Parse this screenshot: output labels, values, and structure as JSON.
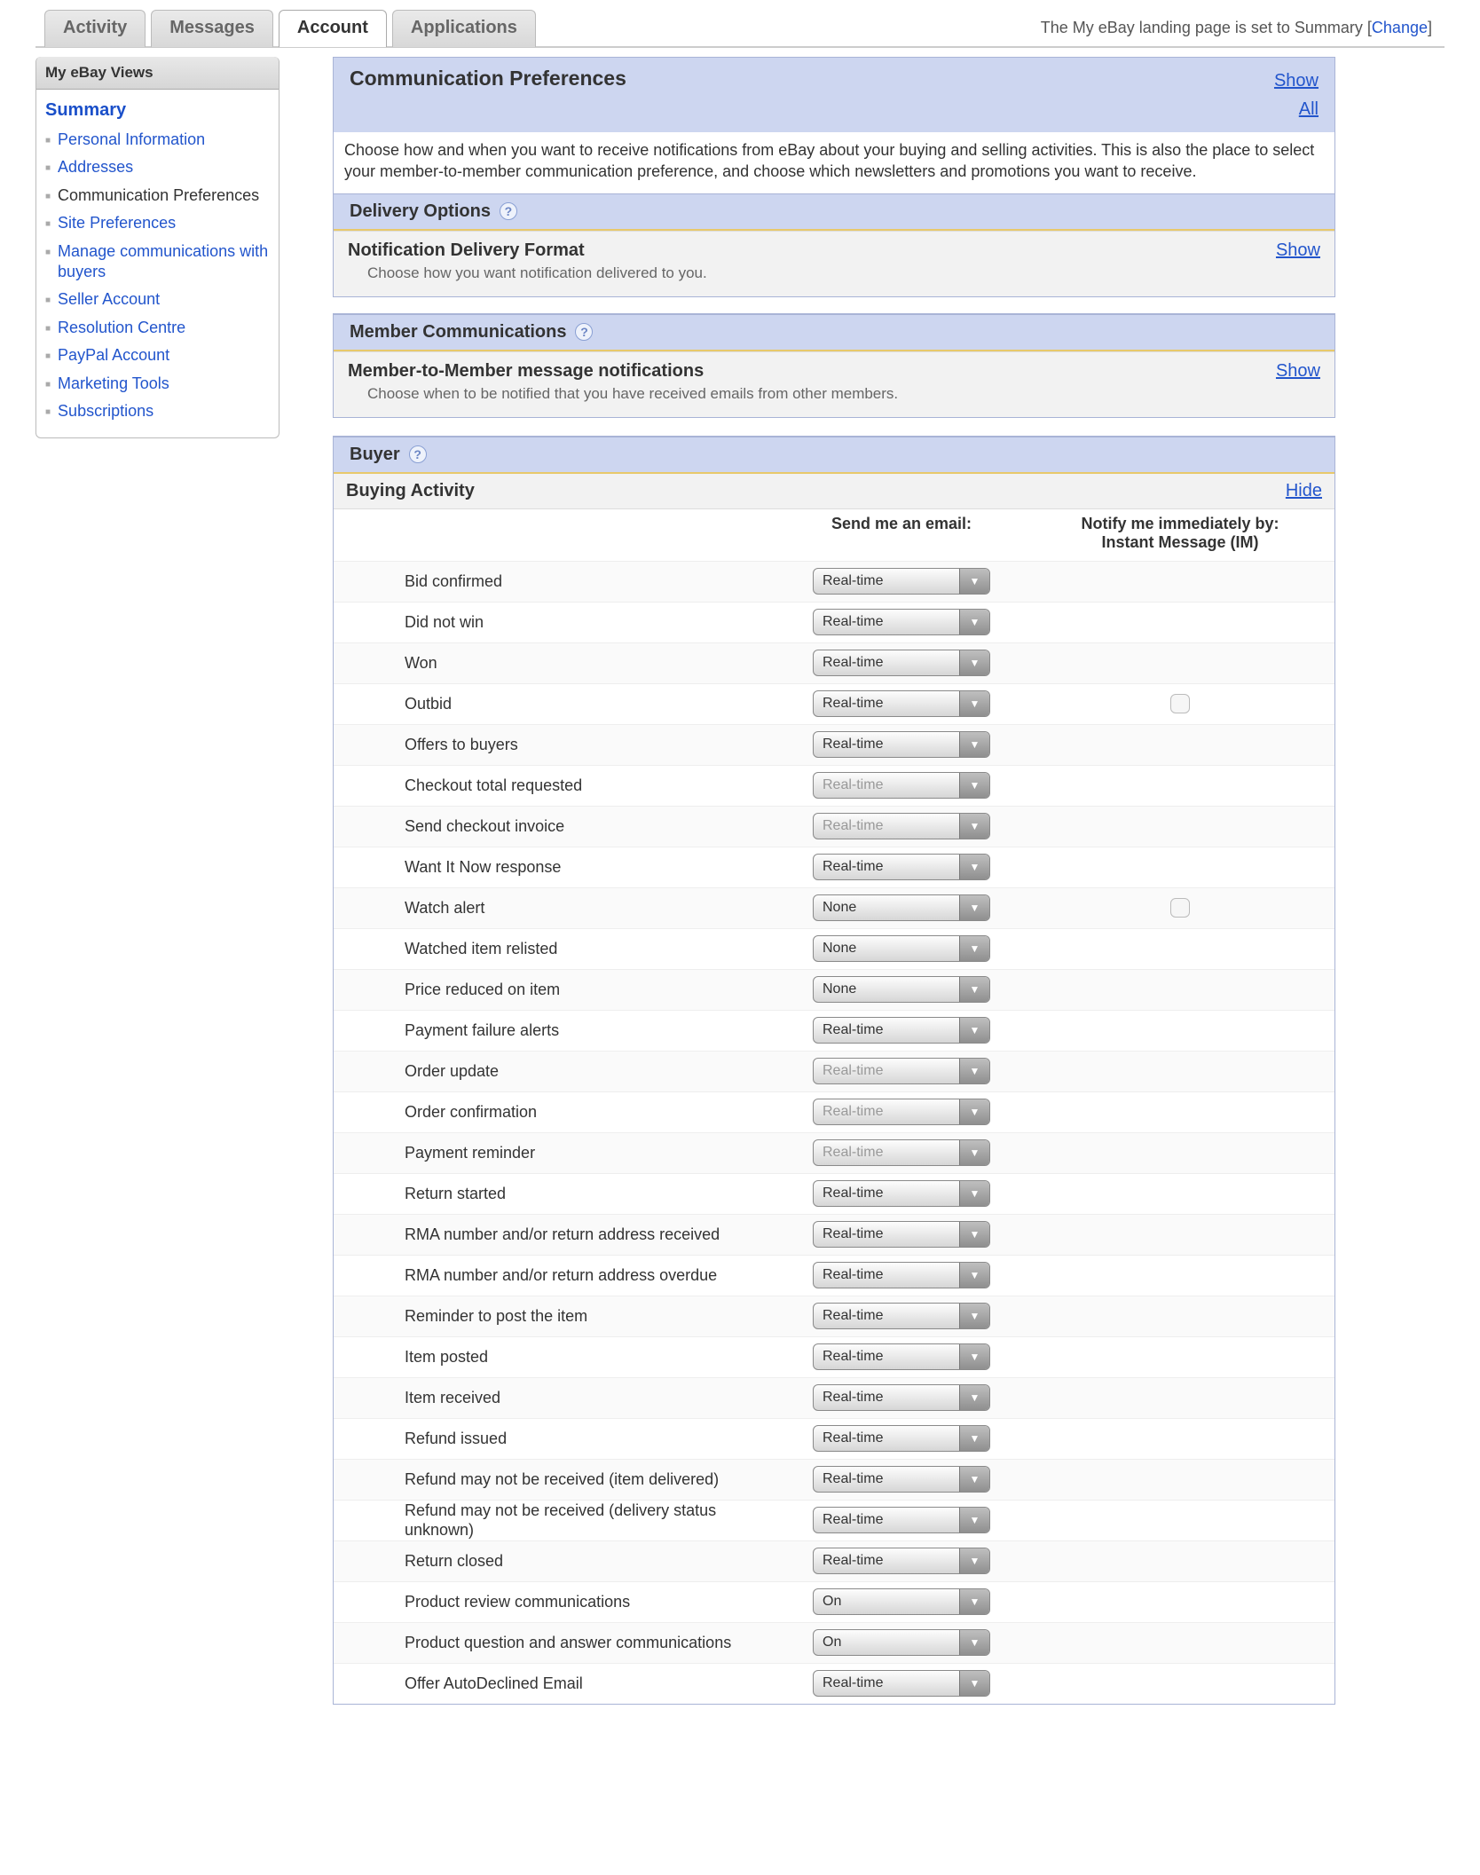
{
  "landing_note": {
    "pre": "The My eBay landing page is set to Summary [",
    "link": "Change",
    "post": "]"
  },
  "tabs": [
    "Activity",
    "Messages",
    "Account",
    "Applications"
  ],
  "active_tab_index": 2,
  "sidebar": {
    "title": "My eBay Views",
    "summary": "Summary",
    "items": [
      "Personal Information",
      "Addresses",
      "Communication Preferences",
      "Site Preferences",
      "Manage communications with buyers",
      "Seller Account",
      "Resolution Centre",
      "PayPal Account",
      "Marketing Tools",
      "Subscriptions"
    ],
    "active_index": 2
  },
  "panel": {
    "title": "Communication Preferences",
    "show": "Show",
    "all": "All",
    "desc": "Choose how and when you want to receive notifications from eBay about your buying and selling activities. This is also the place to select your member-to-member communication preference, and choose which newsletters and promotions you want to receive."
  },
  "delivery": {
    "header": "Delivery Options",
    "box_title": "Notification Delivery Format",
    "box_desc": "Choose how you want notification delivered to you.",
    "show": "Show"
  },
  "member": {
    "header": "Member Communications",
    "box_title": "Member-to-Member message notifications",
    "box_desc": "Choose when to be notified that you have received emails from other members.",
    "show": "Show"
  },
  "buyer": {
    "header": "Buyer",
    "buying_activity": "Buying Activity",
    "hide": "Hide",
    "col_email": "Send me an email:",
    "col_im1": "Notify me immediately by:",
    "col_im2": "Instant Message (IM)"
  },
  "rows": [
    {
      "label": "Bid confirmed",
      "value": "Real-time",
      "disabled": false,
      "im": null
    },
    {
      "label": "Did not win",
      "value": "Real-time",
      "disabled": false,
      "im": null
    },
    {
      "label": "Won",
      "value": "Real-time",
      "disabled": false,
      "im": null
    },
    {
      "label": "Outbid",
      "value": "Real-time",
      "disabled": false,
      "im": false
    },
    {
      "label": "Offers to buyers",
      "value": "Real-time",
      "disabled": false,
      "im": null
    },
    {
      "label": "Checkout total requested",
      "value": "Real-time",
      "disabled": true,
      "im": null
    },
    {
      "label": "Send checkout invoice",
      "value": "Real-time",
      "disabled": true,
      "im": null
    },
    {
      "label": "Want It Now response",
      "value": "Real-time",
      "disabled": false,
      "im": null
    },
    {
      "label": "Watch alert",
      "value": "None",
      "disabled": false,
      "im": false
    },
    {
      "label": "Watched item relisted",
      "value": "None",
      "disabled": false,
      "im": null
    },
    {
      "label": "Price reduced on item",
      "value": "None",
      "disabled": false,
      "im": null
    },
    {
      "label": "Payment failure alerts",
      "value": "Real-time",
      "disabled": false,
      "im": null
    },
    {
      "label": "Order update",
      "value": "Real-time",
      "disabled": true,
      "im": null
    },
    {
      "label": "Order confirmation",
      "value": "Real-time",
      "disabled": true,
      "im": null
    },
    {
      "label": "Payment reminder",
      "value": "Real-time",
      "disabled": true,
      "im": null
    },
    {
      "label": "Return started",
      "value": "Real-time",
      "disabled": false,
      "im": null
    },
    {
      "label": "RMA number and/or return address received",
      "value": "Real-time",
      "disabled": false,
      "im": null
    },
    {
      "label": "RMA number and/or return address overdue",
      "value": "Real-time",
      "disabled": false,
      "im": null
    },
    {
      "label": "Reminder to post the item",
      "value": "Real-time",
      "disabled": false,
      "im": null
    },
    {
      "label": "Item posted",
      "value": "Real-time",
      "disabled": false,
      "im": null
    },
    {
      "label": "Item received",
      "value": "Real-time",
      "disabled": false,
      "im": null
    },
    {
      "label": "Refund issued",
      "value": "Real-time",
      "disabled": false,
      "im": null
    },
    {
      "label": "Refund may not be received (item delivered)",
      "value": "Real-time",
      "disabled": false,
      "im": null
    },
    {
      "label": "Refund may not be received (delivery status unknown)",
      "value": "Real-time",
      "disabled": false,
      "im": null
    },
    {
      "label": "Return closed",
      "value": "Real-time",
      "disabled": false,
      "im": null
    },
    {
      "label": "Product review communications",
      "value": "On",
      "disabled": false,
      "im": null
    },
    {
      "label": "Product question and answer communications",
      "value": "On",
      "disabled": false,
      "im": null
    },
    {
      "label": "Offer AutoDeclined Email",
      "value": "Real-time",
      "disabled": false,
      "im": null
    }
  ]
}
